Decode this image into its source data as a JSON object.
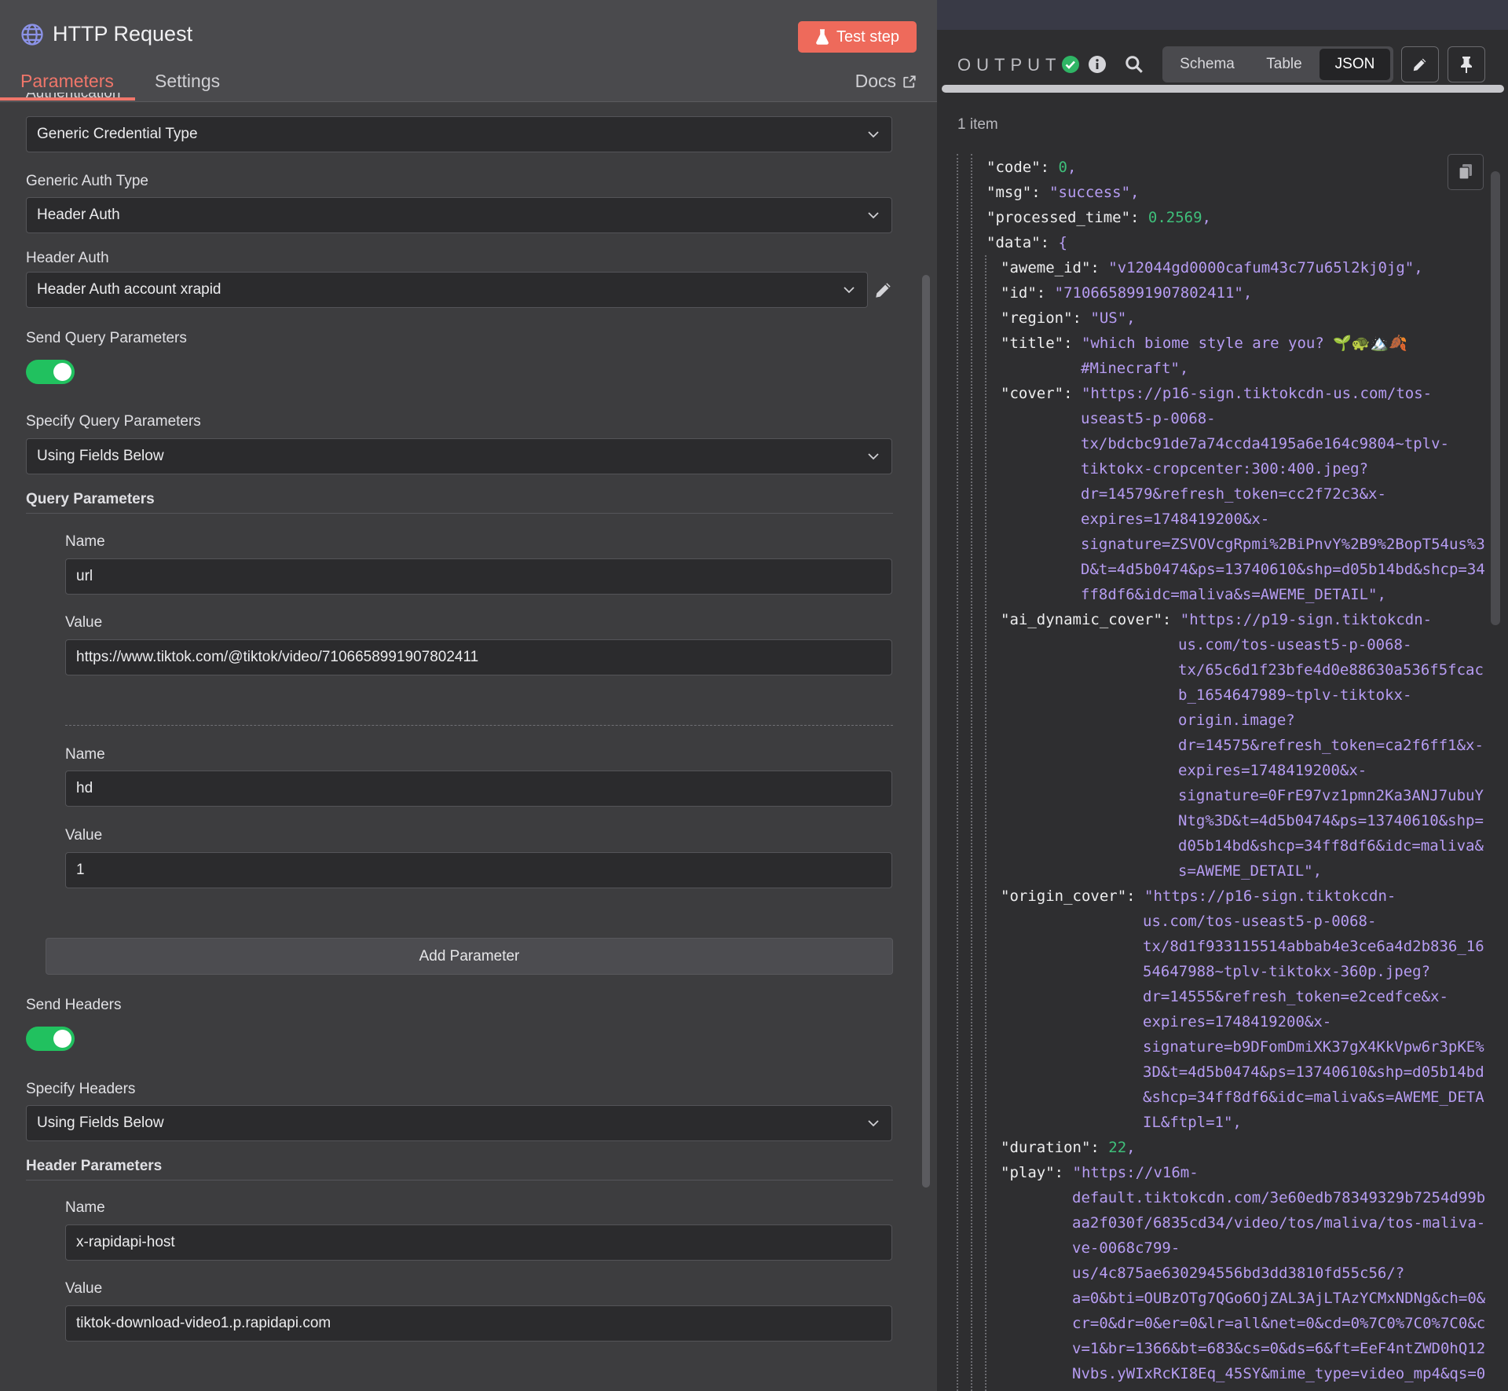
{
  "node": {
    "title": "HTTP Request",
    "test_step_label": "Test step",
    "tabs": [
      "Parameters",
      "Settings"
    ],
    "docs_label": "Docs",
    "cut_label": "Authentication"
  },
  "form": {
    "credential_type_value": "Generic Credential Type",
    "generic_auth_type_label": "Generic Auth Type",
    "generic_auth_type_value": "Header Auth",
    "header_auth_label": "Header Auth",
    "header_auth_value": "Header Auth account xrapid",
    "send_query_label": "Send Query Parameters",
    "send_query_on": true,
    "specify_query_label": "Specify Query Parameters",
    "specify_query_value": "Using Fields Below",
    "query_params_label": "Query Parameters",
    "query_params": [
      {
        "name_label": "Name",
        "name": "url",
        "value_label": "Value",
        "value": "https://www.tiktok.com/@tiktok/video/7106658991907802411"
      },
      {
        "name_label": "Name",
        "name": "hd",
        "value_label": "Value",
        "value": "1"
      }
    ],
    "add_parameter_label": "Add Parameter",
    "send_headers_label": "Send Headers",
    "send_headers_on": true,
    "specify_headers_label": "Specify Headers",
    "specify_headers_value": "Using Fields Below",
    "header_params_label": "Header Parameters",
    "header_params": [
      {
        "name_label": "Name",
        "name": "x-rapidapi-host",
        "value_label": "Value",
        "value": "tiktok-download-video1.p.rapidapi.com"
      }
    ]
  },
  "output": {
    "title": "OUTPUT",
    "views": [
      "Schema",
      "Table",
      "JSON"
    ],
    "active_view": "JSON",
    "item_count": "1 item",
    "json_lines": [
      [
        {
          "t": "k",
          "v": "\"code\": "
        },
        {
          "t": "n",
          "v": "0"
        },
        {
          "t": "p",
          "v": ","
        }
      ],
      [
        {
          "t": "k",
          "v": "\"msg\": "
        },
        {
          "t": "s",
          "v": "\"success\""
        },
        {
          "t": "p",
          "v": ","
        }
      ],
      [
        {
          "t": "k",
          "v": "\"processed_time\": "
        },
        {
          "t": "n",
          "v": "0.2569"
        },
        {
          "t": "p",
          "v": ","
        }
      ],
      [
        {
          "t": "k",
          "v": "\"data\": "
        },
        {
          "t": "p",
          "v": "{"
        }
      ],
      [
        {
          "t": "k",
          "v": "\"aweme_id\": "
        },
        {
          "t": "s",
          "v": "\"v12044gd0000cafum43c77u65l2kj0jg\""
        },
        {
          "t": "p",
          "v": ","
        }
      ],
      [
        {
          "t": "k",
          "v": "\"id\": "
        },
        {
          "t": "s",
          "v": "\"7106658991907802411\""
        },
        {
          "t": "p",
          "v": ","
        }
      ],
      [
        {
          "t": "k",
          "v": "\"region\": "
        },
        {
          "t": "s",
          "v": "\"US\""
        },
        {
          "t": "p",
          "v": ","
        }
      ],
      [
        {
          "t": "k",
          "v": "\"title\": "
        },
        {
          "t": "s",
          "v": "\"which biome style are you? 🌱🐢🏔️🍂"
        }
      ],
      [
        {
          "t": "s",
          "v": "#Minecraft\""
        },
        {
          "t": "p",
          "v": ","
        }
      ],
      [
        {
          "t": "k",
          "v": "\"cover\": "
        },
        {
          "t": "s",
          "v": "\"https://p16-sign.tiktokcdn-us.com/tos-"
        }
      ],
      [
        {
          "t": "s",
          "v": "useast5-p-0068-"
        }
      ],
      [
        {
          "t": "s",
          "v": "tx/bdcbc91de7a74ccda4195a6e164c9804~tplv-"
        }
      ],
      [
        {
          "t": "s",
          "v": "tiktokx-cropcenter:300:400.jpeg?"
        }
      ],
      [
        {
          "t": "s",
          "v": "dr=14579&refresh_token=cc2f72c3&x-"
        }
      ],
      [
        {
          "t": "s",
          "v": "expires=1748419200&x-"
        }
      ],
      [
        {
          "t": "s",
          "v": "signature=ZSVOVcgRpmi%2BiPnvY%2B9%2BopT54us%3"
        }
      ],
      [
        {
          "t": "s",
          "v": "D&t=4d5b0474&ps=13740610&shp=d05b14bd&shcp=34"
        }
      ],
      [
        {
          "t": "s",
          "v": "ff8df6&idc=maliva&s=AWEME_DETAIL\""
        },
        {
          "t": "p",
          "v": ","
        }
      ],
      [
        {
          "t": "k",
          "v": "\"ai_dynamic_cover\": "
        },
        {
          "t": "s",
          "v": "\"https://p19-sign.tiktokcdn-"
        }
      ],
      [
        {
          "t": "s",
          "v": "us.com/tos-useast5-p-0068-"
        }
      ],
      [
        {
          "t": "s",
          "v": "tx/65c6d1f23bfe4d0e88630a536f5fcac"
        }
      ],
      [
        {
          "t": "s",
          "v": "b_1654647989~tplv-tiktokx-"
        }
      ],
      [
        {
          "t": "s",
          "v": "origin.image?"
        }
      ],
      [
        {
          "t": "s",
          "v": "dr=14575&refresh_token=ca2f6ff1&x-"
        }
      ],
      [
        {
          "t": "s",
          "v": "expires=1748419200&x-"
        }
      ],
      [
        {
          "t": "s",
          "v": "signature=0FrE97vz1pmn2Ka3ANJ7ubuY"
        }
      ],
      [
        {
          "t": "s",
          "v": "Ntg%3D&t=4d5b0474&ps=13740610&shp="
        }
      ],
      [
        {
          "t": "s",
          "v": "d05b14bd&shcp=34ff8df6&idc=maliva&"
        }
      ],
      [
        {
          "t": "s",
          "v": "s=AWEME_DETAIL\""
        },
        {
          "t": "p",
          "v": ","
        }
      ],
      [
        {
          "t": "k",
          "v": "\"origin_cover\": "
        },
        {
          "t": "s",
          "v": "\"https://p16-sign.tiktokcdn-"
        }
      ],
      [
        {
          "t": "s",
          "v": "us.com/tos-useast5-p-0068-"
        }
      ],
      [
        {
          "t": "s",
          "v": "tx/8d1f933115514abbab4e3ce6a4d2b836_16"
        }
      ],
      [
        {
          "t": "s",
          "v": "54647988~tplv-tiktokx-360p.jpeg?"
        }
      ],
      [
        {
          "t": "s",
          "v": "dr=14555&refresh_token=e2cedfce&x-"
        }
      ],
      [
        {
          "t": "s",
          "v": "expires=1748419200&x-"
        }
      ],
      [
        {
          "t": "s",
          "v": "signature=b9DFomDmiXK37gX4KkVpw6r3pKE%"
        }
      ],
      [
        {
          "t": "s",
          "v": "3D&t=4d5b0474&ps=13740610&shp=d05b14bd"
        }
      ],
      [
        {
          "t": "s",
          "v": "&shcp=34ff8df6&idc=maliva&s=AWEME_DETA"
        }
      ],
      [
        {
          "t": "s",
          "v": "IL&ftpl=1\""
        },
        {
          "t": "p",
          "v": ","
        }
      ],
      [
        {
          "t": "k",
          "v": "\"duration\": "
        },
        {
          "t": "n",
          "v": "22"
        },
        {
          "t": "p",
          "v": ","
        }
      ],
      [
        {
          "t": "k",
          "v": "\"play\": "
        },
        {
          "t": "s",
          "v": "\"https://v16m-"
        }
      ],
      [
        {
          "t": "s",
          "v": "default.tiktokcdn.com/3e60edb78349329b7254d99b"
        }
      ],
      [
        {
          "t": "s",
          "v": "aa2f030f/6835cd34/video/tos/maliva/tos-maliva-"
        }
      ],
      [
        {
          "t": "s",
          "v": "ve-0068c799-"
        }
      ],
      [
        {
          "t": "s",
          "v": "us/4c875ae630294556bd3dd3810fd55c56/?"
        }
      ],
      [
        {
          "t": "s",
          "v": "a=0&bti=OUBzOTg7QGo6OjZAL3AjLTAzYCMxNDNg&ch=0&"
        }
      ],
      [
        {
          "t": "s",
          "v": "cr=0&dr=0&er=0&lr=all&net=0&cd=0%7C0%7C0%7C0&c"
        }
      ],
      [
        {
          "t": "s",
          "v": "v=1&br=1366&bt=683&cs=0&ds=6&ft=EeF4ntZWD0hQ12"
        }
      ],
      [
        {
          "t": "s",
          "v": "Nvbs.yWIxRcKI8Eq_45SY&mime_type=video_mp4&qs=0"
        }
      ]
    ]
  },
  "colors": {
    "accent": "#f0766a",
    "test_button": "#ee6a5b",
    "toggle_on": "#21c15f",
    "json_string": "#b69cf2",
    "json_number": "#3fbf7a"
  }
}
